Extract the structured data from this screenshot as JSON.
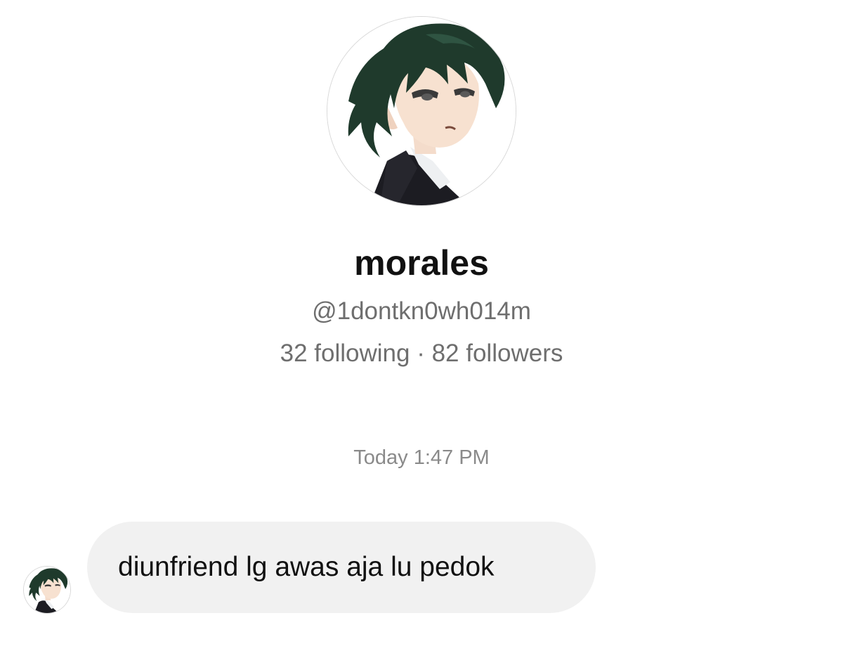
{
  "profile": {
    "avatar_icon": "anime-character-avatar-icon",
    "display_name": "morales",
    "handle": "@1dontkn0wh014m",
    "stats": "32 following · 82 followers"
  },
  "conversation": {
    "timestamp": "Today 1:47 PM",
    "messages": [
      {
        "sender_avatar_icon": "anime-character-avatar-icon",
        "text": "diunfriend lg awas aja lu pedok"
      }
    ]
  },
  "colors": {
    "background": "#ffffff",
    "bubble": "#f1f1f1",
    "secondary_text": "#6e6e6e",
    "hair": "#1f3a2c"
  }
}
